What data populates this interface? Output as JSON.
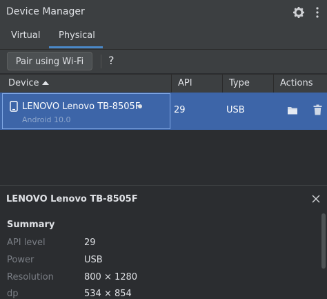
{
  "window": {
    "title": "Device Manager",
    "icons": [
      "gear-icon",
      "more-icon"
    ]
  },
  "tabs": [
    {
      "label": "Virtual",
      "selected": false
    },
    {
      "label": "Physical",
      "selected": true
    }
  ],
  "toolbar": {
    "pair_label": "Pair using Wi-Fi",
    "help_label": "?"
  },
  "table": {
    "columns": {
      "device": "Device",
      "api": "API",
      "type": "Type",
      "actions": "Actions"
    },
    "sort": "ascending",
    "rows": [
      {
        "name": "LENOVO Lenovo TB-8505F",
        "subtitle": "Android 10.0",
        "api": "29",
        "type": "USB",
        "icons": [
          "phone-icon",
          "folder-icon",
          "trash-icon"
        ]
      }
    ]
  },
  "details": {
    "title": "LENOVO Lenovo TB-8505F",
    "section": "Summary",
    "properties": [
      {
        "label": "API level",
        "value": "29"
      },
      {
        "label": "Power",
        "value": "USB"
      },
      {
        "label": "Resolution",
        "value": "800 × 1280"
      },
      {
        "label": "dp",
        "value": "534 × 854"
      }
    ]
  },
  "colors": {
    "selection": "#3d65a8",
    "accent": "#4a88c7",
    "background": "#2b2d30"
  }
}
